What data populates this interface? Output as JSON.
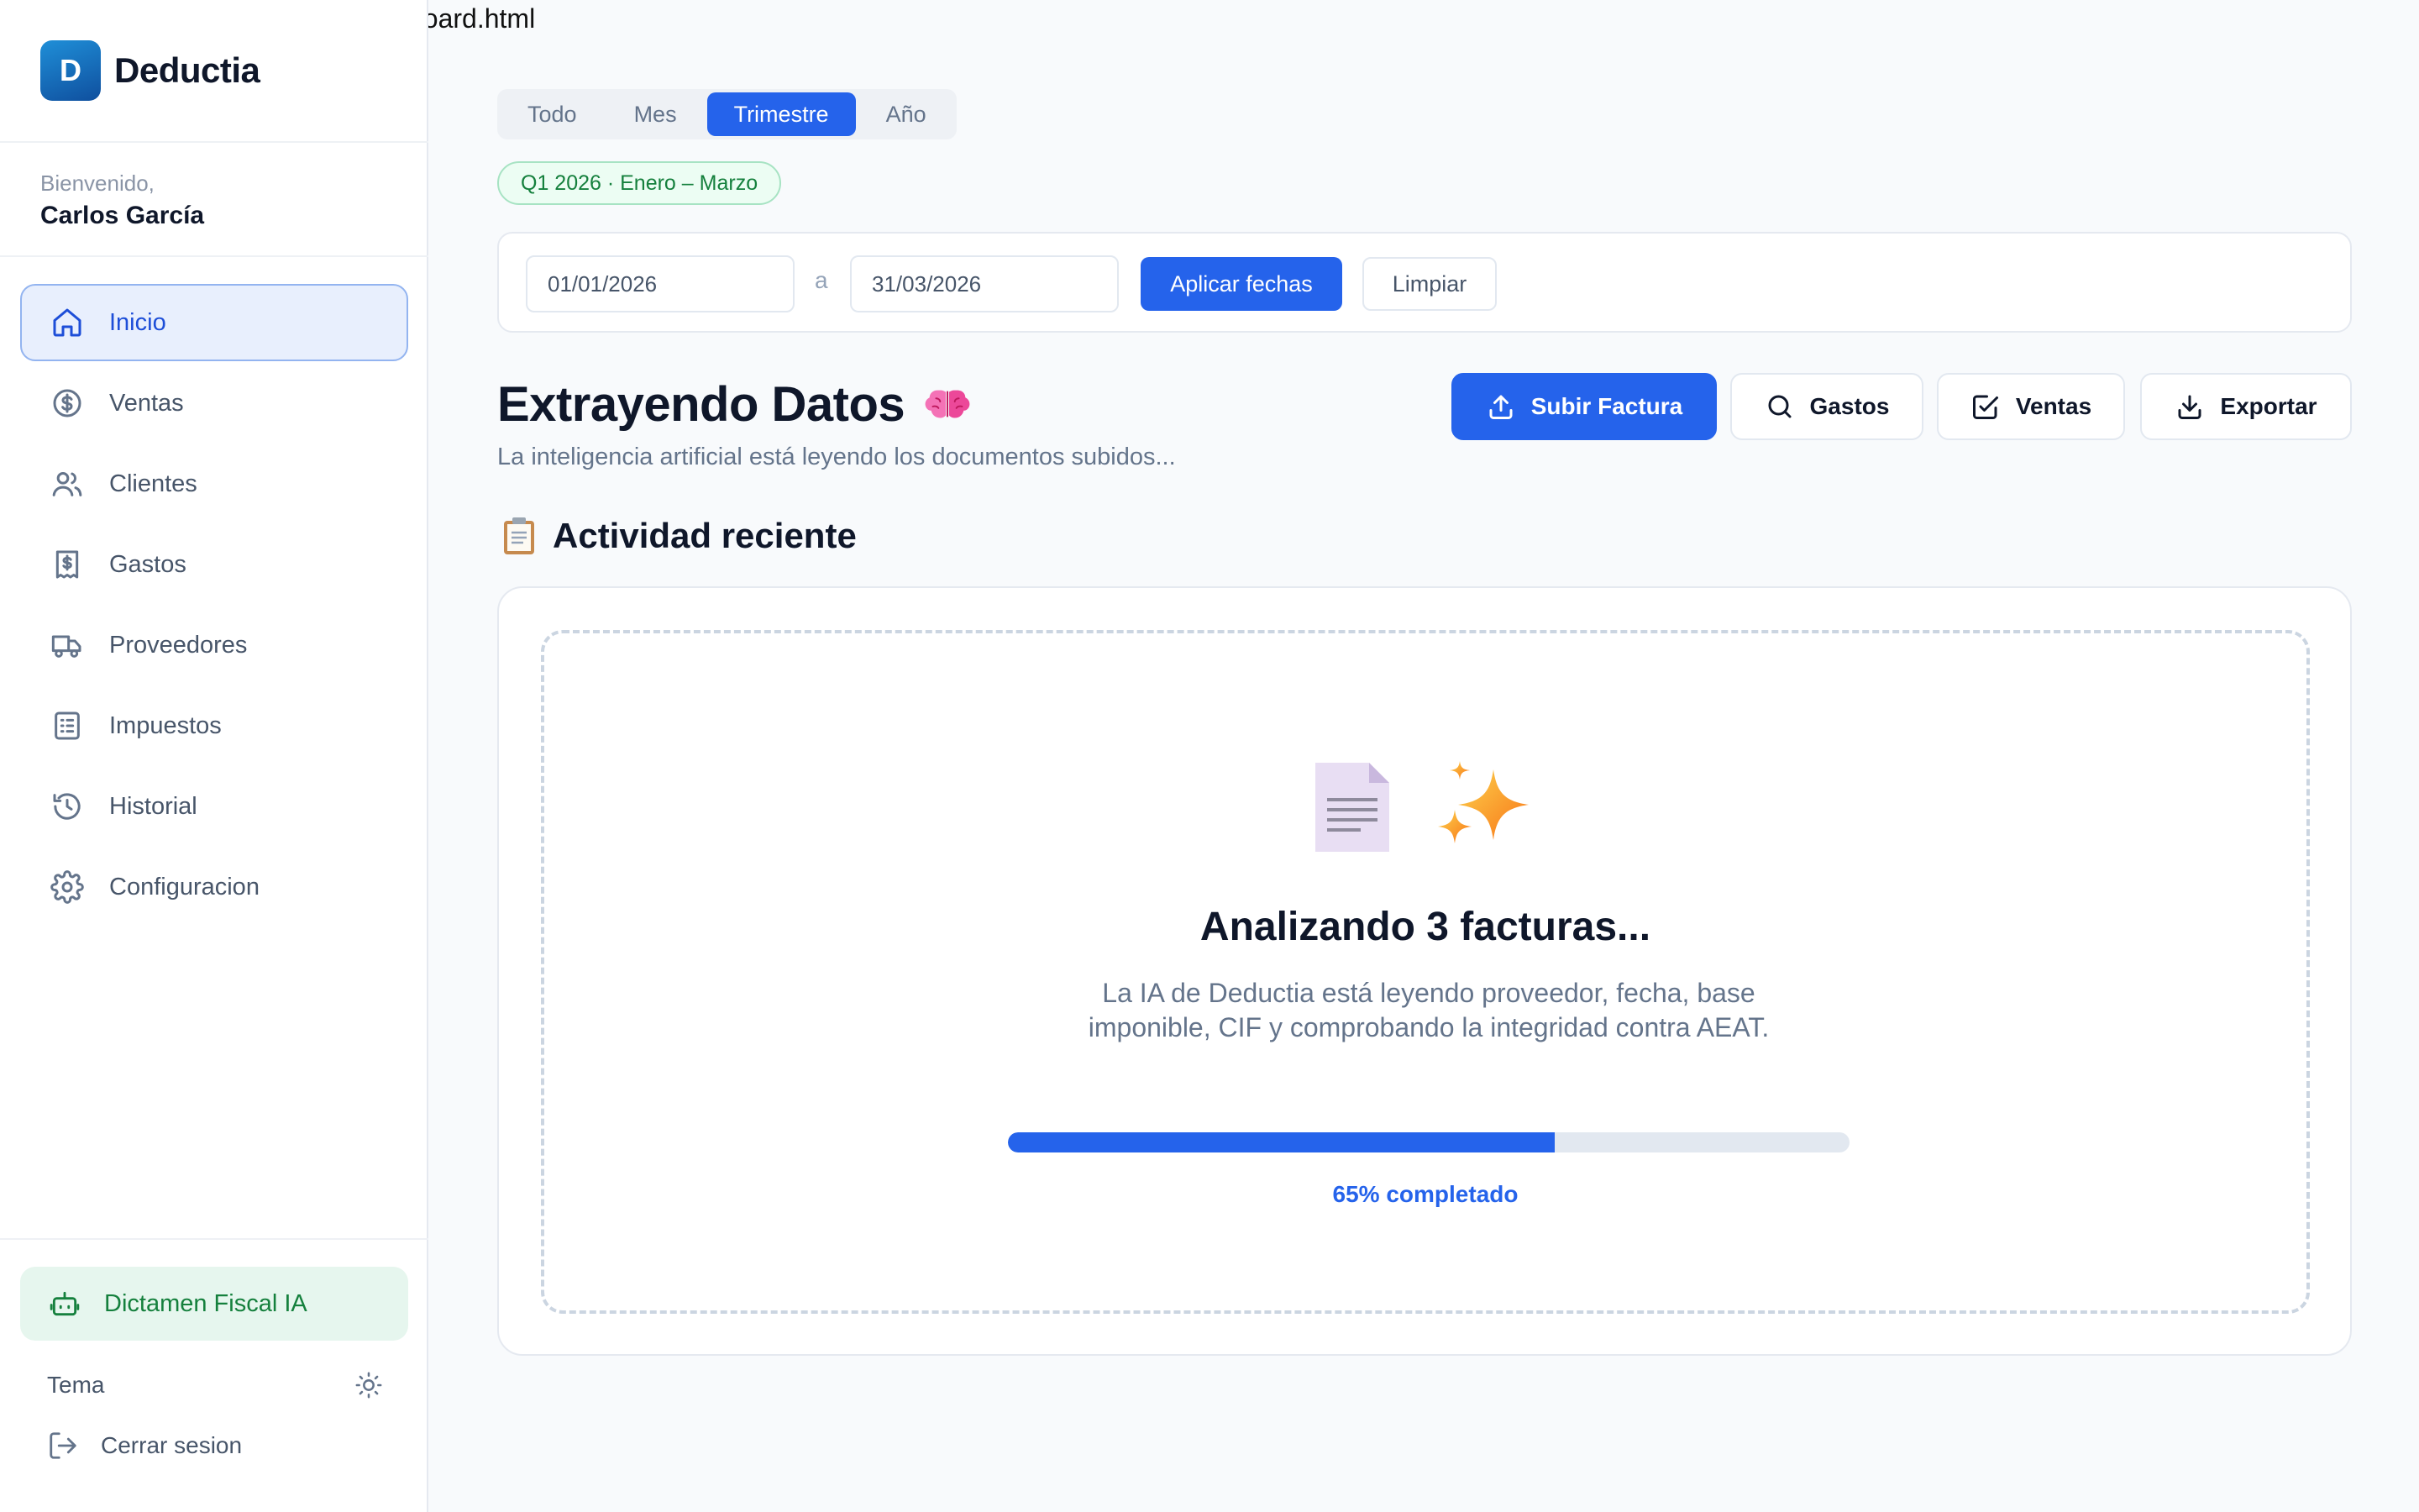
{
  "browser": {
    "tab_title": "board.html"
  },
  "sidebar": {
    "brand_letter": "D",
    "brand_name": "Deductia",
    "welcome_label": "Bienvenido,",
    "user_name": "Carlos García",
    "items": [
      {
        "label": "Inicio",
        "icon": "home-icon",
        "active": true
      },
      {
        "label": "Ventas",
        "icon": "dollar-circle-icon"
      },
      {
        "label": "Clientes",
        "icon": "users-icon"
      },
      {
        "label": "Gastos",
        "icon": "receipt-icon"
      },
      {
        "label": "Proveedores",
        "icon": "truck-icon"
      },
      {
        "label": "Impuestos",
        "icon": "ledger-icon"
      },
      {
        "label": "Historial",
        "icon": "history-icon"
      },
      {
        "label": "Configuracion",
        "icon": "gear-icon"
      }
    ],
    "ai_button": "Dictamen Fiscal IA",
    "theme_label": "Tema",
    "logout_label": "Cerrar sesion"
  },
  "filters": {
    "periods": [
      "Todo",
      "Mes",
      "Trimestre",
      "Año"
    ],
    "active_period": "Trimestre",
    "quarter_badge": "Q1 2026 · Enero – Marzo",
    "date_from": "01/01/2026",
    "date_separator": "a",
    "date_to": "31/03/2026",
    "apply_label": "Aplicar fechas",
    "clear_label": "Limpiar"
  },
  "header": {
    "title": "Extrayendo Datos",
    "subtitle": "La inteligencia artificial está leyendo los documentos subidos...",
    "actions": {
      "upload": "Subir Factura",
      "expenses": "Gastos",
      "sales": "Ventas",
      "export": "Exportar"
    }
  },
  "activity": {
    "title": "Actividad reciente",
    "analyzing_title": "Analizando 3 facturas...",
    "analyzing_desc": "La IA de Deductia está leyendo proveedor, fecha, base imponible, CIF y comprobando la integridad contra AEAT.",
    "progress_percent": 65,
    "progress_label": "65% completado"
  },
  "colors": {
    "accent": "#2563eb",
    "success": "#15803d",
    "text": "#0f172a",
    "muted": "#64748b"
  }
}
